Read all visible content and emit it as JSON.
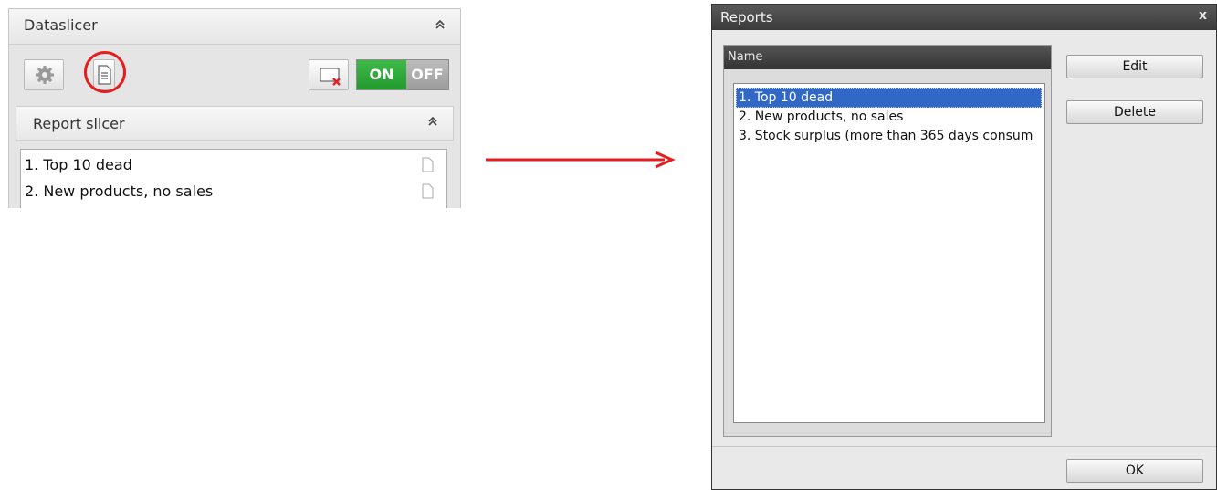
{
  "dataslicer": {
    "title": "Dataslicer",
    "collapse_icon": "double-chevron-up-icon",
    "toolbar": {
      "settings_icon": "gear-icon",
      "reports_icon": "document-icon",
      "clear_icon": "clear-filter-icon",
      "toggle_on": "ON",
      "toggle_off": "OFF"
    },
    "report_slicer": {
      "title": "Report slicer",
      "items": [
        {
          "label": "1. Top 10 dead"
        },
        {
          "label": "2. New products, no sales"
        }
      ]
    }
  },
  "reports_dialog": {
    "title": "Reports",
    "close": "x",
    "column_header": "Name",
    "items": [
      {
        "label": "1. Top 10 dead",
        "selected": true
      },
      {
        "label": "2. New products, no sales",
        "selected": false
      },
      {
        "label": "3. Stock surplus (more than 365 days consum",
        "selected": false
      }
    ],
    "buttons": {
      "edit": "Edit",
      "delete": "Delete",
      "ok": "OK"
    }
  },
  "colors": {
    "highlight": "#e41e1e",
    "toggle_on": "#2fa83a",
    "selection": "#3168c6",
    "arrow": "#e41e1e"
  }
}
